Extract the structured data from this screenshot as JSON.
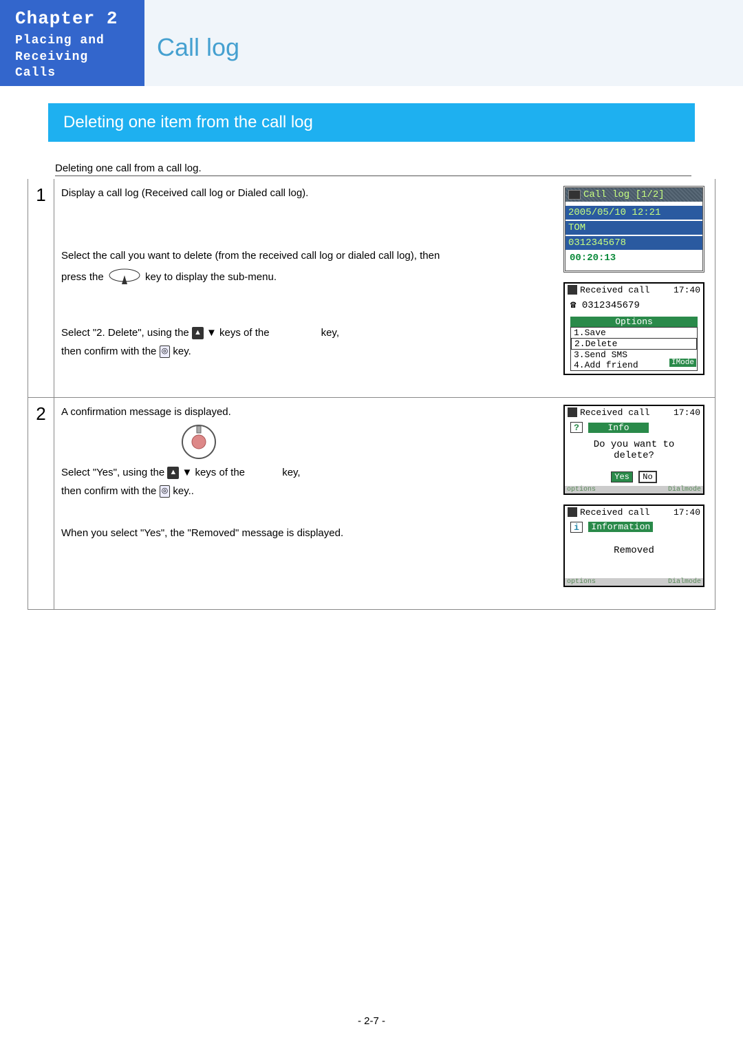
{
  "header": {
    "chapter": "Chapter 2",
    "subtitle_line1": "Placing and",
    "subtitle_line2": "Receiving Calls",
    "page_title": "Call log"
  },
  "section_title": "Deleting one item from the call log",
  "intro": "Deleting one call from a call log.",
  "steps": [
    {
      "num": "1",
      "para1": "Display a call log (Received call log or Dialed call log).",
      "para2a": "Select the call you want to delete (from the received call log or dialed call log), then",
      "para2b_pre": "press the",
      "para2b_post": "key to display the sub-menu.",
      "para3a_pre": "Select \"2. Delete\", using the",
      "para3a_mid": "keys of the",
      "para3a_post": "key,",
      "para3b_pre": "then confirm with the",
      "para3b_post": "key.",
      "screen1": {
        "title": "Call log [1/2]",
        "datetime": "2005/05/10 12:21",
        "name": "TOM",
        "number": "0312345678",
        "duration": "00:20:13"
      },
      "screen2": {
        "title": "Received call",
        "time": "17:40",
        "number": "0312345679",
        "options_hdr": "Options",
        "opt1": "1.Save",
        "opt2": "2.Delete",
        "opt3": "3.Send SMS",
        "opt4": "4.Add friend",
        "mode": "IMode"
      }
    },
    {
      "num": "2",
      "para1": "A confirmation message is displayed.",
      "para2a_pre": "Select \"Yes\", using the",
      "para2a_mid": "keys of the",
      "para2a_post": "key,",
      "para2b_pre": "then confirm with the",
      "para2b_post": "key..",
      "para3": "When you select \"Yes\", the \"Removed\" message is displayed.",
      "screen1": {
        "title": "Received call",
        "time": "17:40",
        "info": "Info",
        "msg1": "Do you want to",
        "msg2": "delete?",
        "yes": "Yes",
        "no": "No",
        "soft_l": "options",
        "soft_r": "Dialmode"
      },
      "screen2": {
        "title": "Received call",
        "time": "17:40",
        "info": "Information",
        "msg": "Removed",
        "soft_l": "options",
        "soft_r": "Dialmode"
      }
    }
  ],
  "icons": {
    "ok_key": "◎",
    "down_arrow": "▼",
    "up_arrow": "▲"
  },
  "footer": {
    "page": "- 2-7 -"
  }
}
